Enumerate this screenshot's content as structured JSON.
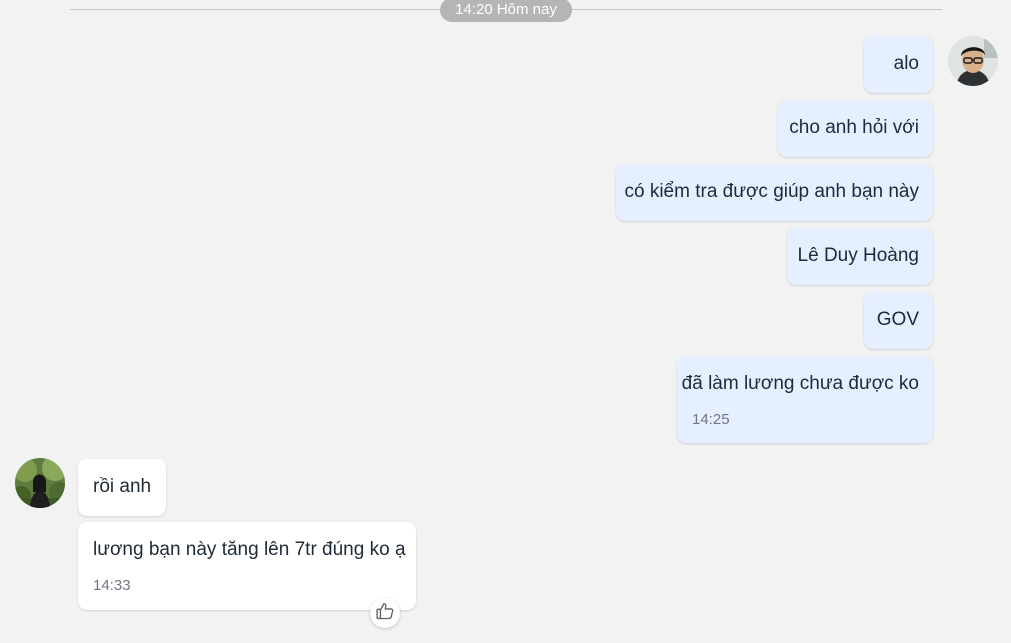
{
  "divider": {
    "label": "14:20 Hôm nay"
  },
  "outgoing": {
    "messages": [
      "alo",
      "cho anh hỏi với",
      "có kiểm tra được giúp anh bạn này",
      "Lê Duy Hoàng",
      "GOV",
      "đã làm lương chưa được ko"
    ],
    "timestamp": "14:25"
  },
  "incoming": {
    "messages": [
      "rồi anh",
      "lương bạn này tăng lên 7tr đúng ko ạ"
    ],
    "timestamp": "14:33"
  },
  "colors": {
    "background": "#f2f2f2",
    "outgoing_bubble": "#e5efff",
    "incoming_bubble": "#ffffff",
    "divider_pill": "#b5b5b5"
  },
  "icons": {
    "self_avatar": "person-glasses-photo",
    "contact_avatar": "person-outdoor-photo",
    "reaction": "thumbs-up-icon"
  }
}
